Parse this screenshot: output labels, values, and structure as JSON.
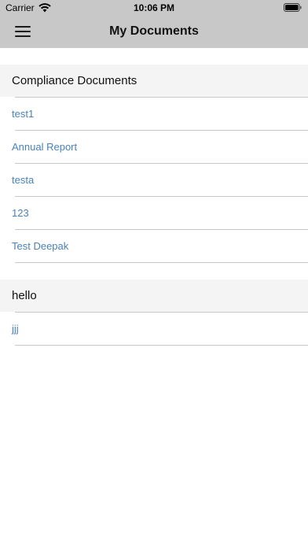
{
  "status_bar": {
    "carrier": "Carrier",
    "time": "10:06 PM",
    "wifi_icon": "wifi-icon",
    "battery_icon": "battery-icon"
  },
  "nav": {
    "menu_icon": "hamburger-menu-icon",
    "title": "My Documents"
  },
  "colors": {
    "bar_background": "#c8c8c8",
    "section_background": "#f4f4f4",
    "link": "#4a82b8",
    "separator": "#c8c8c8"
  },
  "sections": [
    {
      "title": "Compliance Documents",
      "items": [
        "test1",
        "Annual Report",
        "testa",
        "123",
        "Test Deepak"
      ]
    },
    {
      "title": "hello",
      "items": [
        "jjj"
      ]
    }
  ]
}
